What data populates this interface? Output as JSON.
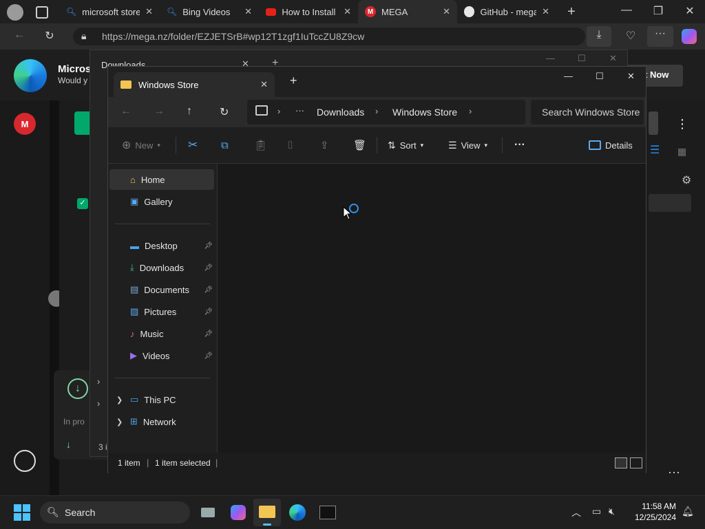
{
  "browser": {
    "tabs": [
      {
        "label": "microsoft store",
        "icon": "search-icon"
      },
      {
        "label": "Bing Videos",
        "icon": "search-icon"
      },
      {
        "label": "How to Install I",
        "icon": "youtube-icon"
      },
      {
        "label": "MEGA",
        "icon": "mega-icon"
      },
      {
        "label": "GitHub - mega",
        "icon": "github-icon"
      }
    ],
    "url": "https://mega.nz/folder/EZJETSrB#wp12T1zgf1IuTccZU8Z9cw"
  },
  "page": {
    "banner_title": "Microso",
    "banner_sub": "Would y",
    "banner_button": "t Now"
  },
  "back_window": {
    "title": "Downloads",
    "partial_labels": [
      "In pro",
      "3 i"
    ]
  },
  "explorer": {
    "tab_title": "Windows Store",
    "breadcrumb": [
      "Downloads",
      "Windows Store"
    ],
    "breadcrumb_overflow": "···",
    "search_placeholder": "Search Windows Store",
    "commands": {
      "new": "New",
      "sort": "Sort",
      "view": "View",
      "more": "···",
      "details": "Details"
    },
    "sidebar": {
      "top": [
        {
          "label": "Home",
          "icon": "home-icon"
        },
        {
          "label": "Gallery",
          "icon": "gallery-icon"
        }
      ],
      "pinned": [
        {
          "label": "Desktop",
          "icon": "desktop-icon"
        },
        {
          "label": "Downloads",
          "icon": "downloads-icon"
        },
        {
          "label": "Documents",
          "icon": "documents-icon"
        },
        {
          "label": "Pictures",
          "icon": "pictures-icon"
        },
        {
          "label": "Music",
          "icon": "music-icon"
        },
        {
          "label": "Videos",
          "icon": "videos-icon"
        }
      ],
      "bottom": [
        {
          "label": "This PC",
          "icon": "this-pc-icon"
        },
        {
          "label": "Network",
          "icon": "network-icon"
        }
      ]
    },
    "status": {
      "items": "1 item",
      "selected": "1 item selected"
    }
  },
  "taskbar": {
    "search_label": "Search",
    "time": "11:58 AM",
    "date": "12/25/2024"
  },
  "colors": {
    "accent": "#0078d4",
    "mega_red": "#d9272e",
    "mega_green": "#00a86b"
  }
}
